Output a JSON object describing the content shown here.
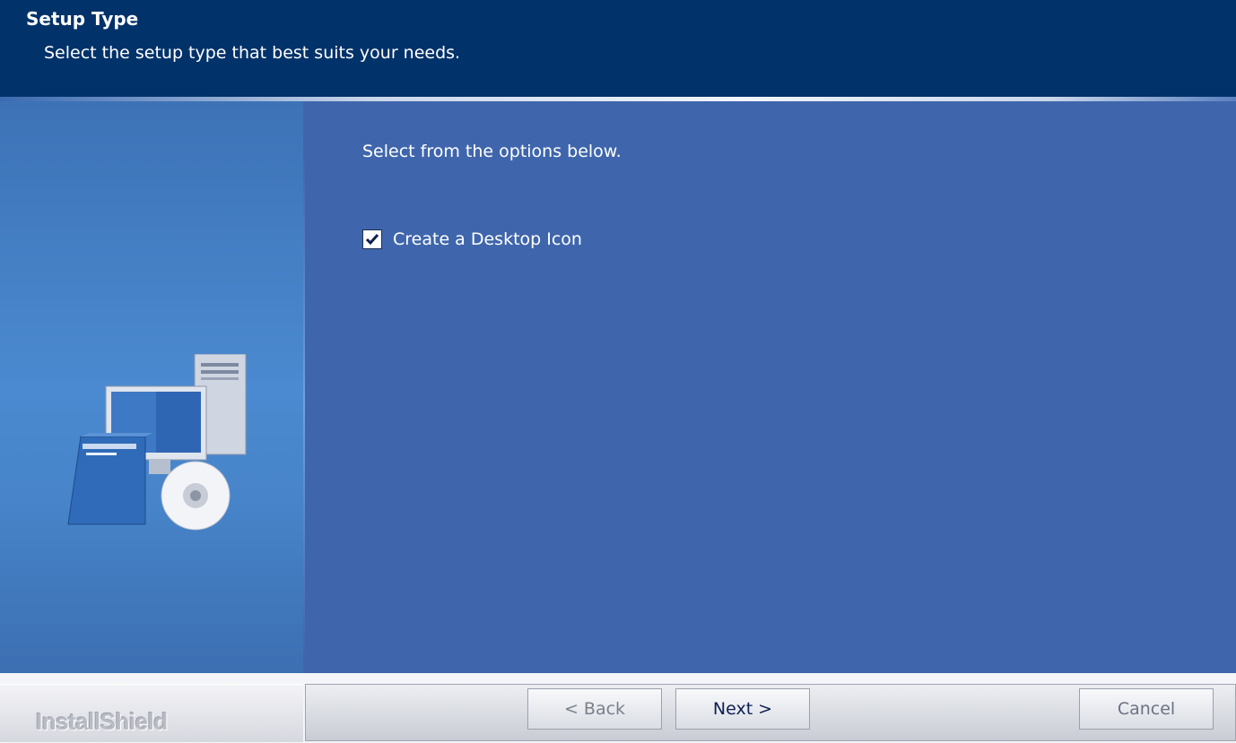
{
  "header": {
    "title": "Setup Type",
    "subtitle": "Select the setup type that best suits your needs."
  },
  "main": {
    "instructions": "Select from the options below.",
    "options": [
      {
        "label": "Create a Desktop Icon",
        "checked": true
      }
    ]
  },
  "footer": {
    "brand": "InstallShield",
    "buttons": {
      "back": "< Back",
      "next": "Next >",
      "cancel": "Cancel"
    }
  },
  "colors": {
    "header_bg": "#02326a",
    "main_bg": "#3f66ac",
    "footer_bg": "#f4f5f8"
  },
  "icons": [
    "computer-setup-illustration",
    "checkmark-icon"
  ]
}
